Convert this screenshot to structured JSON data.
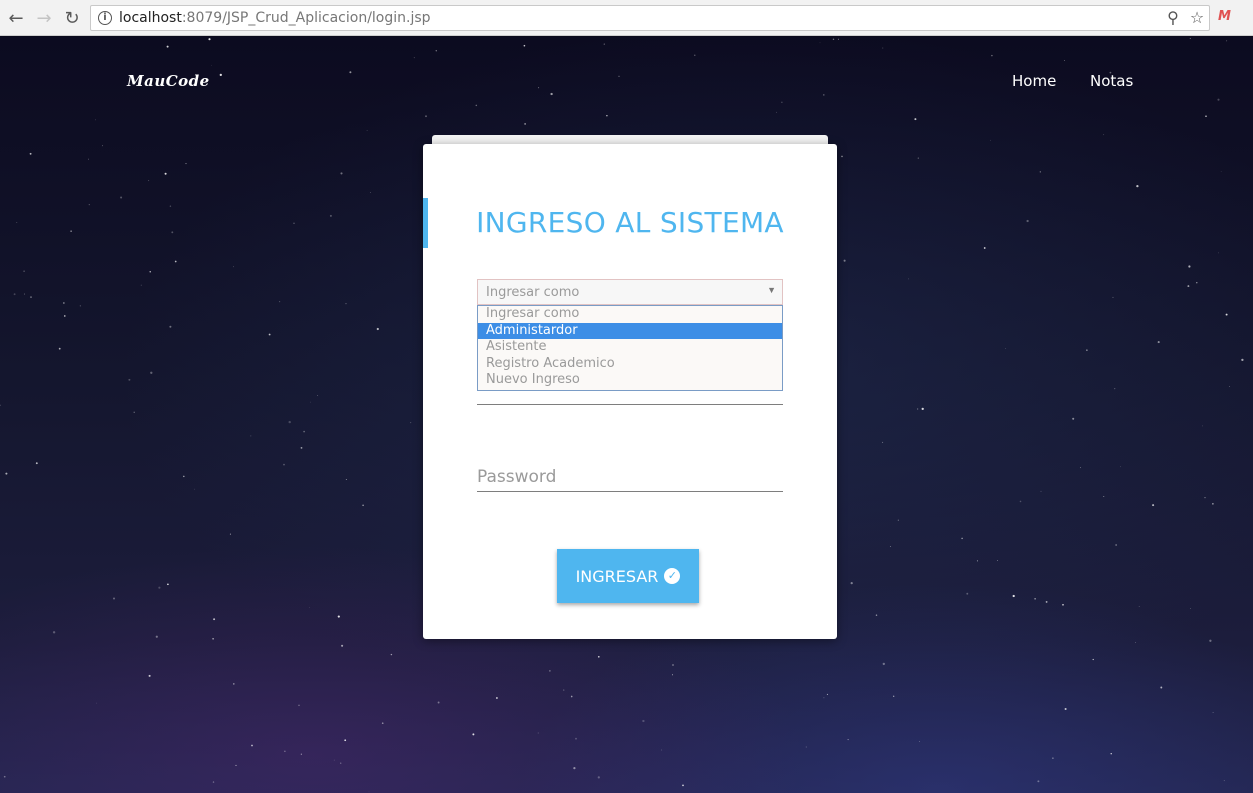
{
  "browser": {
    "url_host": "localhost",
    "url_rest": ":8079/JSP_Crud_Aplicacion/login.jsp",
    "icons": [
      "back-arrow-icon",
      "forward-arrow-icon",
      "reload-icon",
      "info-icon",
      "zoom-icon",
      "star-icon",
      "extension-icon"
    ],
    "extension_label": "M"
  },
  "nav": {
    "brand": "MauCode",
    "links": [
      "Home",
      "Notas"
    ]
  },
  "login": {
    "title": "INGRESO AL SISTEMA",
    "role_select": {
      "selected": "Ingresar como",
      "options": [
        "Ingresar como",
        "Administardor",
        "Asistente",
        "Registro Academico",
        "Nuevo Ingreso"
      ],
      "highlighted_index": 1
    },
    "password_placeholder": "Password",
    "submit_label": "INGRESAR"
  },
  "colors": {
    "accent": "#4fb6ef",
    "highlight": "#3d8ee6"
  }
}
